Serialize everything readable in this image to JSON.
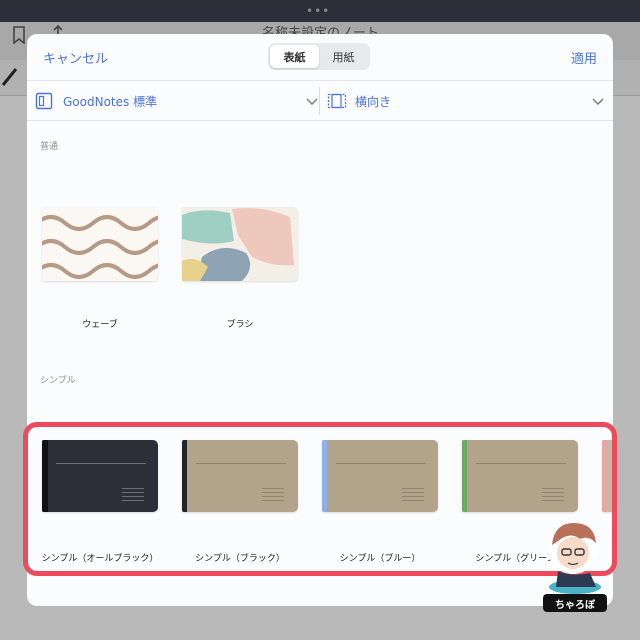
{
  "background_app": {
    "title": "名称未設定のノート"
  },
  "header": {
    "cancel_label": "キャンセル",
    "apply_label": "適用",
    "tabs": [
      {
        "label": "表紙",
        "active": true
      },
      {
        "label": "用紙",
        "active": false
      }
    ]
  },
  "template_bar": {
    "template_label": "GoodNotes 標準",
    "orientation_label": "横向き"
  },
  "sections": {
    "standard": {
      "label": "普通",
      "items": [
        {
          "label": "ウェーブ"
        },
        {
          "label": "ブラシ"
        }
      ]
    },
    "simple": {
      "label": "シンプル",
      "items": [
        {
          "label": "シンプル（オールブラック）",
          "body_color": "#2d2f38",
          "spine_color": "#111111"
        },
        {
          "label": "シンプル（ブラック）",
          "body_color": "#b1a48a",
          "spine_color": "#22242c"
        },
        {
          "label": "シンプル（ブルー）",
          "body_color": "#b1a48a",
          "spine_color": "#8fb0ea"
        },
        {
          "label": "シンプル（グリーン）",
          "body_color": "#b1a48a",
          "spine_color": "#6aa864"
        }
      ]
    }
  },
  "watermark": {
    "label": "ちゃろぼ"
  },
  "colors": {
    "accent": "#4b73d9",
    "highlight": "#ee4a5c"
  }
}
